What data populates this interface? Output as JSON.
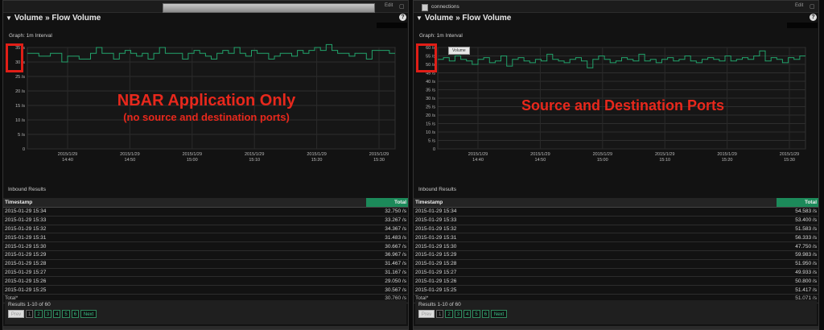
{
  "panels": [
    {
      "id": "left",
      "tab_label": "",
      "edit_label": "Edit",
      "title": "Volume » Flow Volume",
      "graph_label": "Graph: 1m Interval",
      "legend_label": "",
      "annotation_main": "NBAR Application Only",
      "annotation_sub": "(no source and destination ports)",
      "inbound_label": "Inbound Results",
      "columns": [
        "Timestamp",
        "Total"
      ],
      "rows": [
        [
          "2015-01-29 15:34",
          "32.750 /s"
        ],
        [
          "2015-01-29 15:33",
          "33.267 /s"
        ],
        [
          "2015-01-29 15:32",
          "34.367 /s"
        ],
        [
          "2015-01-29 15:31",
          "31.483 /s"
        ],
        [
          "2015-01-29 15:30",
          "30.667 /s"
        ],
        [
          "2015-01-29 15:29",
          "36.967 /s"
        ],
        [
          "2015-01-29 15:28",
          "31.467 /s"
        ],
        [
          "2015-01-29 15:27",
          "31.167 /s"
        ],
        [
          "2015-01-29 15:26",
          "29.050 /s"
        ],
        [
          "2015-01-29 15:25",
          "30.567 /s"
        ]
      ],
      "total_label": "Total*",
      "total_value": "30.760 /s",
      "results_info": "Results 1-10 of 60",
      "pager": [
        "Prev",
        "1",
        "2",
        "3",
        "4",
        "5",
        "6",
        "Next"
      ],
      "chart": {
        "type": "line",
        "y_ticks": [
          "0",
          "5 /s",
          "10 /s",
          "15 /s",
          "20 /s",
          "25 /s",
          "30 /s",
          "35 /s"
        ],
        "ymax": 35,
        "x_ticks": [
          {
            "date": "2015/1/29",
            "time": "14:40"
          },
          {
            "date": "2015/1/29",
            "time": "14:50"
          },
          {
            "date": "2015/1/29",
            "time": "15:00"
          },
          {
            "date": "2015/1/29",
            "time": "15:10"
          },
          {
            "date": "2015/1/29",
            "time": "15:20"
          },
          {
            "date": "2015/1/29",
            "time": "15:30"
          }
        ],
        "values": [
          33,
          33,
          32,
          32,
          33,
          33,
          30,
          32,
          32,
          31,
          31,
          33,
          35,
          33,
          33,
          31,
          33,
          34,
          33,
          32,
          33,
          31,
          33,
          35,
          33,
          33,
          33,
          31,
          33,
          34,
          33,
          32,
          31,
          33,
          34,
          33,
          35,
          33,
          32,
          34,
          33,
          33,
          31,
          32,
          33,
          33,
          32,
          34,
          33,
          34,
          35,
          34,
          36,
          34,
          33,
          33,
          32,
          33,
          33,
          31,
          34,
          34,
          34,
          33
        ],
        "line_color": "#22a36b"
      }
    },
    {
      "id": "right",
      "tab_label": "connections",
      "edit_label": "Edit",
      "title": "Volume » Flow Volume",
      "graph_label": "Graph: 1m Interval",
      "legend_label": "Volume",
      "annotation_main": "Source and Destination Ports",
      "annotation_sub": "",
      "inbound_label": "Inbound Results",
      "columns": [
        "Timestamp",
        "Total"
      ],
      "rows": [
        [
          "2015-01-29 15:34",
          "54.583 /s"
        ],
        [
          "2015-01-29 15:33",
          "53.400 /s"
        ],
        [
          "2015-01-29 15:32",
          "51.583 /s"
        ],
        [
          "2015-01-29 15:31",
          "56.333 /s"
        ],
        [
          "2015-01-29 15:30",
          "47.750 /s"
        ],
        [
          "2015-01-29 15:29",
          "59.983 /s"
        ],
        [
          "2015-01-29 15:28",
          "51.950 /s"
        ],
        [
          "2015-01-29 15:27",
          "49.933 /s"
        ],
        [
          "2015-01-29 15:26",
          "50.800 /s"
        ],
        [
          "2015-01-29 15:25",
          "51.417 /s"
        ]
      ],
      "total_label": "Total*",
      "total_value": "51.071 /s",
      "results_info": "Results 1-10 of 60",
      "pager": [
        "Prev",
        "1",
        "2",
        "3",
        "4",
        "5",
        "6",
        "Next"
      ],
      "chart": {
        "type": "line",
        "y_ticks": [
          "0",
          "5 /s",
          "10 /s",
          "15 /s",
          "20 /s",
          "25 /s",
          "30 /s",
          "35 /s",
          "40 /s",
          "45 /s",
          "50 /s",
          "55 /s",
          "60 /s"
        ],
        "ymax": 60,
        "x_ticks": [
          {
            "date": "2015/1/29",
            "time": "14:40"
          },
          {
            "date": "2015/1/29",
            "time": "14:50"
          },
          {
            "date": "2015/1/29",
            "time": "15:00"
          },
          {
            "date": "2015/1/29",
            "time": "15:10"
          },
          {
            "date": "2015/1/29",
            "time": "15:20"
          },
          {
            "date": "2015/1/29",
            "time": "15:30"
          }
        ],
        "values": [
          53,
          54,
          52,
          55,
          53,
          52,
          50,
          53,
          54,
          51,
          52,
          55,
          49,
          53,
          54,
          52,
          51,
          53,
          52,
          56,
          53,
          52,
          51,
          53,
          54,
          52,
          48,
          53,
          55,
          53,
          51,
          52,
          54,
          53,
          52,
          56,
          52,
          53,
          51,
          53,
          54,
          52,
          53,
          55,
          52,
          51,
          53,
          54,
          53,
          52,
          55,
          52,
          53,
          54,
          53,
          55,
          58,
          52,
          54,
          53,
          51,
          54,
          53,
          55
        ],
        "line_color": "#22a36b"
      }
    }
  ]
}
